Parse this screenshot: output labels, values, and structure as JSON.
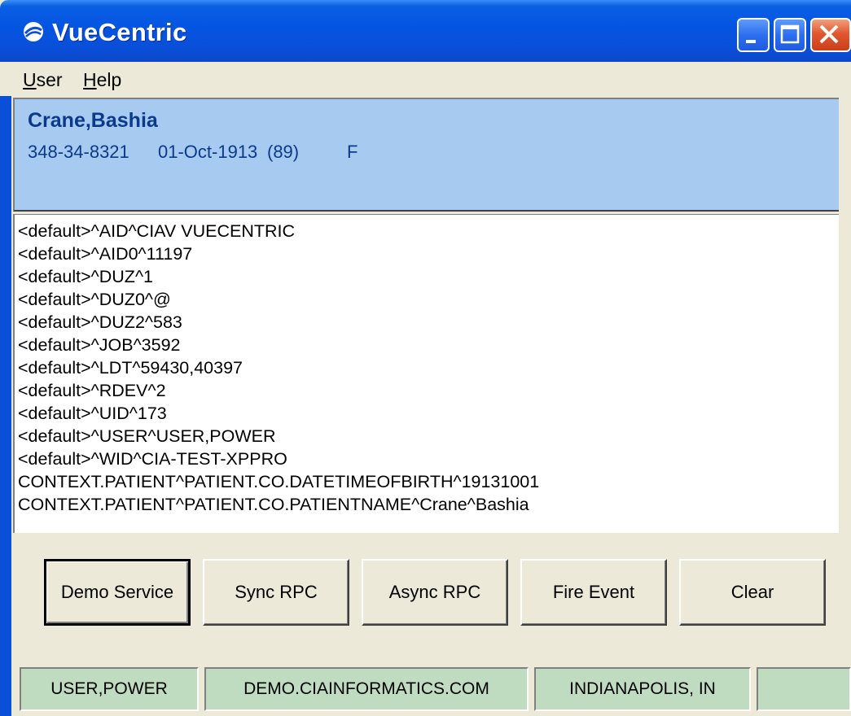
{
  "window": {
    "title": "VueCentric"
  },
  "menu": [
    {
      "ul": "U",
      "rest": "ser"
    },
    {
      "ul": "H",
      "rest": "elp"
    }
  ],
  "patient": {
    "name": "Crane,Bashia",
    "ssn": "348-34-8321",
    "dob": "01-Oct-1913",
    "age": "(89)",
    "sex": "F"
  },
  "log": [
    "<default>^AID^CIAV VUECENTRIC",
    "<default>^AID0^11197",
    "<default>^DUZ^1",
    "<default>^DUZ0^@",
    "<default>^DUZ2^583",
    "<default>^JOB^3592",
    "<default>^LDT^59430,40397",
    "<default>^RDEV^2",
    "<default>^UID^173",
    "<default>^USER^USER,POWER",
    "<default>^WID^CIA-TEST-XPPRO",
    "CONTEXT.PATIENT^PATIENT.CO.DATETIMEOFBIRTH^19131001",
    "CONTEXT.PATIENT^PATIENT.CO.PATIENTNAME^Crane^Bashia"
  ],
  "buttons": {
    "demo_service": "Demo Service",
    "sync_rpc": "Sync RPC",
    "async_rpc": "Async RPC",
    "fire_event": "Fire Event",
    "clear": "Clear"
  },
  "status": {
    "user": "USER,POWER",
    "server": "DEMO.CIAINFORMATICS.COM",
    "location": "INDIANAPOLIS, IN",
    "extra": ""
  }
}
